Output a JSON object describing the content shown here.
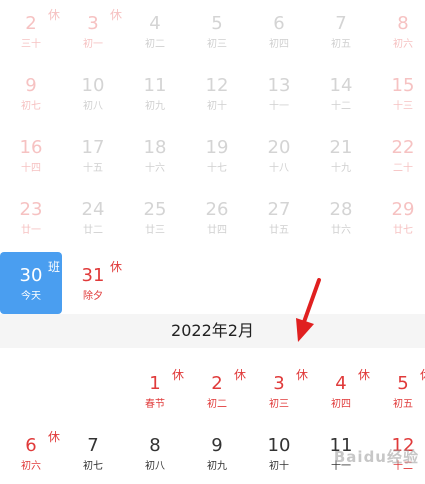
{
  "prev_month_rows": [
    [
      {
        "day": "2",
        "lunar": "三十",
        "type": "red",
        "badge": "休"
      },
      {
        "day": "3",
        "lunar": "初一",
        "type": "red",
        "badge": "休"
      },
      {
        "day": "4",
        "lunar": "初二",
        "type": "normal",
        "badge": ""
      },
      {
        "day": "5",
        "lunar": "初三",
        "type": "normal",
        "badge": ""
      },
      {
        "day": "6",
        "lunar": "初四",
        "type": "normal",
        "badge": ""
      },
      {
        "day": "7",
        "lunar": "初五",
        "type": "normal",
        "badge": ""
      },
      {
        "day": "8",
        "lunar": "初六",
        "type": "red",
        "badge": ""
      }
    ],
    [
      {
        "day": "9",
        "lunar": "初七",
        "type": "red",
        "badge": ""
      },
      {
        "day": "10",
        "lunar": "初八",
        "type": "normal",
        "badge": ""
      },
      {
        "day": "11",
        "lunar": "初九",
        "type": "normal",
        "badge": ""
      },
      {
        "day": "12",
        "lunar": "初十",
        "type": "normal",
        "badge": ""
      },
      {
        "day": "13",
        "lunar": "十一",
        "type": "normal",
        "badge": ""
      },
      {
        "day": "14",
        "lunar": "十二",
        "type": "normal",
        "badge": ""
      },
      {
        "day": "15",
        "lunar": "十三",
        "type": "red",
        "badge": ""
      }
    ],
    [
      {
        "day": "16",
        "lunar": "十四",
        "type": "red",
        "badge": ""
      },
      {
        "day": "17",
        "lunar": "十五",
        "type": "normal",
        "badge": ""
      },
      {
        "day": "18",
        "lunar": "十六",
        "type": "normal",
        "badge": ""
      },
      {
        "day": "19",
        "lunar": "十七",
        "type": "normal",
        "badge": ""
      },
      {
        "day": "20",
        "lunar": "十八",
        "type": "normal",
        "badge": ""
      },
      {
        "day": "21",
        "lunar": "十九",
        "type": "normal",
        "badge": ""
      },
      {
        "day": "22",
        "lunar": "二十",
        "type": "red",
        "badge": ""
      }
    ],
    [
      {
        "day": "23",
        "lunar": "廿一",
        "type": "red",
        "badge": ""
      },
      {
        "day": "24",
        "lunar": "廿二",
        "type": "normal",
        "badge": ""
      },
      {
        "day": "25",
        "lunar": "廿三",
        "type": "normal",
        "badge": ""
      },
      {
        "day": "26",
        "lunar": "廿四",
        "type": "normal",
        "badge": ""
      },
      {
        "day": "27",
        "lunar": "廿五",
        "type": "normal",
        "badge": ""
      },
      {
        "day": "28",
        "lunar": "廿六",
        "type": "normal",
        "badge": ""
      },
      {
        "day": "29",
        "lunar": "廿七",
        "type": "red",
        "badge": ""
      }
    ]
  ],
  "last_row": [
    {
      "day": "30",
      "lunar": "今天",
      "type": "today",
      "badge": "班"
    },
    {
      "day": "31",
      "lunar": "除夕",
      "type": "red",
      "badge": "休"
    }
  ],
  "month_header": "2022年2月",
  "next_month_rows": [
    [
      {
        "day": "",
        "lunar": "",
        "type": "empty",
        "badge": ""
      },
      {
        "day": "",
        "lunar": "",
        "type": "empty",
        "badge": ""
      },
      {
        "day": "1",
        "lunar": "春节",
        "type": "red",
        "badge": "休"
      },
      {
        "day": "2",
        "lunar": "初二",
        "type": "red",
        "badge": "休"
      },
      {
        "day": "3",
        "lunar": "初三",
        "type": "red",
        "badge": "休"
      },
      {
        "day": "4",
        "lunar": "初四",
        "type": "red",
        "badge": "休"
      },
      {
        "day": "5",
        "lunar": "初五",
        "type": "red",
        "badge": "休"
      }
    ],
    [
      {
        "day": "6",
        "lunar": "初六",
        "type": "red",
        "badge": "休"
      },
      {
        "day": "7",
        "lunar": "初七",
        "type": "normal",
        "badge": ""
      },
      {
        "day": "8",
        "lunar": "初八",
        "type": "normal",
        "badge": ""
      },
      {
        "day": "9",
        "lunar": "初九",
        "type": "normal",
        "badge": ""
      },
      {
        "day": "10",
        "lunar": "初十",
        "type": "normal",
        "badge": ""
      },
      {
        "day": "11",
        "lunar": "十一",
        "type": "normal",
        "badge": ""
      },
      {
        "day": "12",
        "lunar": "十二",
        "type": "red",
        "badge": ""
      }
    ]
  ],
  "watermark": "Baidu经验",
  "colors": {
    "accent": "#4a9ef0",
    "holiday_red": "#e03a3a",
    "arrow": "#e02020"
  }
}
